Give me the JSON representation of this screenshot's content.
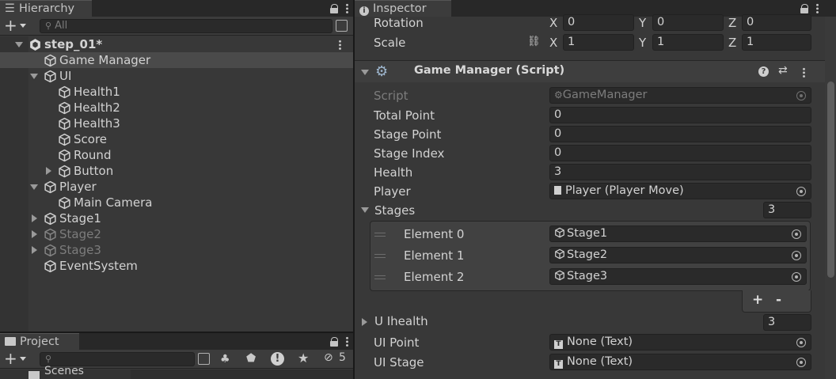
{
  "hierarchy": {
    "tab_label": "Hierarchy",
    "search_placeholder": "All",
    "items": [
      {
        "label": "step_01*",
        "level": 0
      },
      {
        "label": "Game Manager",
        "level": 1
      },
      {
        "label": "UI",
        "level": 1
      },
      {
        "label": "Health1",
        "level": 2
      },
      {
        "label": "Health2",
        "level": 2
      },
      {
        "label": "Health3",
        "level": 2
      },
      {
        "label": "Score",
        "level": 2
      },
      {
        "label": "Round",
        "level": 2
      },
      {
        "label": "Button",
        "level": 2
      },
      {
        "label": "Player",
        "level": 1
      },
      {
        "label": "Main Camera",
        "level": 2
      },
      {
        "label": "Stage1",
        "level": 1
      },
      {
        "label": "Stage2",
        "level": 1
      },
      {
        "label": "Stage3",
        "level": 1
      },
      {
        "label": "EventSystem",
        "level": 1
      }
    ]
  },
  "project": {
    "tab_label": "Project",
    "hidden_count": "5",
    "partial_folder": "Scenes"
  },
  "inspector": {
    "tab_label": "Inspector",
    "transform": {
      "rotation_label": "Rotation",
      "rotation": {
        "x": "0",
        "y": "0",
        "z": "0"
      },
      "scale_label": "Scale",
      "scale": {
        "x": "1",
        "y": "1",
        "z": "1"
      },
      "axis_x": "X",
      "axis_y": "Y",
      "axis_z": "Z"
    },
    "component": {
      "title": "Game Manager (Script)",
      "script_label": "Script",
      "script_value": "GameManager",
      "total_point_label": "Total Point",
      "total_point": "0",
      "stage_point_label": "Stage Point",
      "stage_point": "0",
      "stage_index_label": "Stage Index",
      "stage_index": "0",
      "health_label": "Health",
      "health": "3",
      "player_label": "Player",
      "player_value": "Player (Player Move)",
      "stages_label": "Stages",
      "stages_count": "3",
      "stages": [
        {
          "label": "Element 0",
          "value": "Stage1"
        },
        {
          "label": "Element 1",
          "value": "Stage2"
        },
        {
          "label": "Element 2",
          "value": "Stage3"
        }
      ],
      "add_label": "+",
      "remove_label": "-",
      "uihealth_label": "U Ihealth",
      "uihealth_count": "3",
      "uipoint_label": "UI Point",
      "uipoint_value": "None (Text)",
      "uistage_label": "UI Stage",
      "uistage_value": "None (Text)"
    }
  }
}
